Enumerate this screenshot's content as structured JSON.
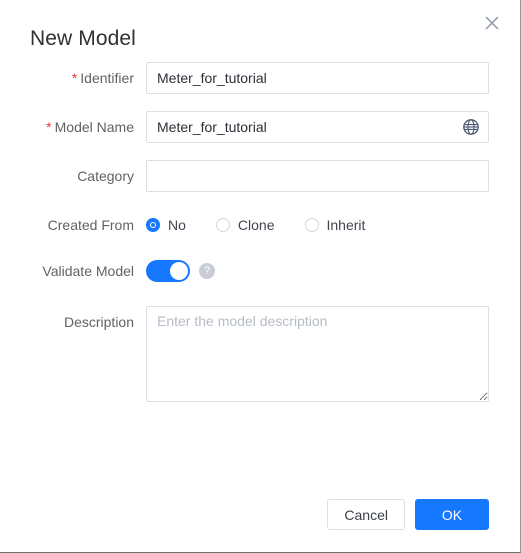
{
  "dialog": {
    "title": "New Model",
    "close_icon": "close-icon"
  },
  "form": {
    "identifier": {
      "label": "Identifier",
      "required_mark": "*",
      "value": "Meter_for_tutorial",
      "placeholder": ""
    },
    "model_name": {
      "label": "Model Name",
      "required_mark": "*",
      "value": "Meter_for_tutorial",
      "placeholder": "",
      "icon": "globe-icon"
    },
    "category": {
      "label": "Category",
      "value": "",
      "placeholder": ""
    },
    "created_from": {
      "label": "Created From",
      "selected": "No",
      "options": [
        {
          "label": "No",
          "checked": true
        },
        {
          "label": "Clone",
          "checked": false
        },
        {
          "label": "Inherit",
          "checked": false
        }
      ]
    },
    "validate_model": {
      "label": "Validate Model",
      "enabled": true,
      "help_icon_text": "?"
    },
    "description": {
      "label": "Description",
      "value": "",
      "placeholder": "Enter the model description"
    }
  },
  "footer": {
    "cancel_label": "Cancel",
    "ok_label": "OK"
  },
  "colors": {
    "accent": "#1677ff",
    "required": "#e4393c",
    "label": "#606266",
    "border": "#dcdfe6"
  }
}
